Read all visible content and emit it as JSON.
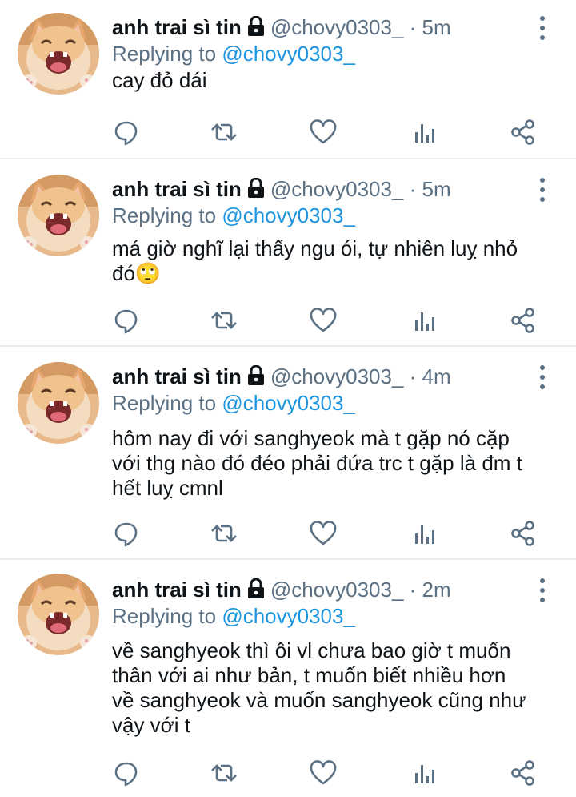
{
  "tweets": [
    {
      "name": "anh trai sì tin",
      "handle": "@chovy0303_",
      "time": "· 5m",
      "reply_prefix": "Replying to ",
      "reply_to": "@chovy0303_",
      "text_lines": [
        "cay đỏ dái"
      ]
    },
    {
      "name": "anh trai sì tin",
      "handle": "@chovy0303_",
      "time": "· 5m",
      "reply_prefix": "Replying to ",
      "reply_to": "@chovy0303_",
      "text_lines": [
        "má giờ nghĩ lại thấy ngu ói, tự nhiên luỵ nhỏ",
        "đó🙄"
      ]
    },
    {
      "name": "anh trai sì tin",
      "handle": "@chovy0303_",
      "time": "· 4m",
      "reply_prefix": "Replying to ",
      "reply_to": "@chovy0303_",
      "text_lines": [
        "hôm nay đi với sanghyeok mà t gặp nó cặp",
        "với thg nào đó đéo phải đứa trc t gặp là đm t",
        "hết luỵ cmnl"
      ]
    },
    {
      "name": "anh trai sì tin",
      "handle": "@chovy0303_",
      "time": "· 2m",
      "reply_prefix": "Replying to ",
      "reply_to": "@chovy0303_",
      "text_lines": [
        "về sanghyeok thì ôi vl chưa bao giờ t muốn",
        "thân với ai như bản, t muốn biết nhiều hơn",
        "về sanghyeok và muốn sanghyeok cũng như",
        "vậy với t"
      ]
    }
  ],
  "icons": {
    "lock": "lock-icon",
    "more": "more-vertical-icon",
    "reply": "reply-icon",
    "retweet": "retweet-icon",
    "like": "heart-icon",
    "analytics": "analytics-icon",
    "share": "share-icon"
  },
  "colors": {
    "text": "#0f1419",
    "secondary": "#5b7083",
    "mention": "#1b95e0",
    "divider": "#e6ecf0"
  }
}
